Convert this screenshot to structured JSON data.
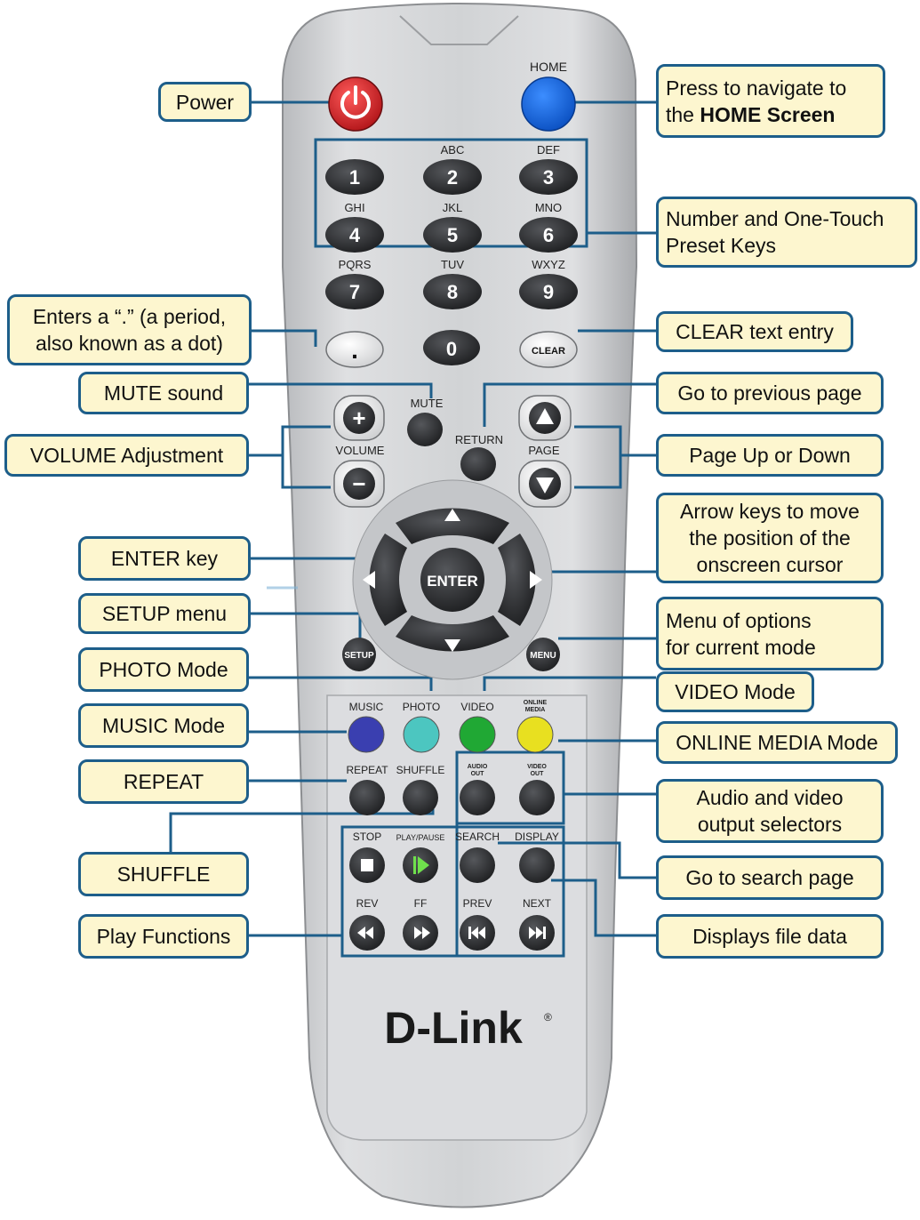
{
  "remote": {
    "colors": {
      "body": "#cfd1d4",
      "panel": "#dcdde0",
      "key": "#2f3033",
      "line": "#1d5e8a",
      "callout_bg": "#fdf6cf"
    },
    "top_keys": {
      "home_label": "HOME"
    },
    "number_keys": [
      {
        "digit": "1",
        "letters": ""
      },
      {
        "digit": "2",
        "letters": "ABC"
      },
      {
        "digit": "3",
        "letters": "DEF"
      },
      {
        "digit": "4",
        "letters": "GHI"
      },
      {
        "digit": "5",
        "letters": "JKL"
      },
      {
        "digit": "6",
        "letters": "MNO"
      },
      {
        "digit": "7",
        "letters": "PQRS"
      },
      {
        "digit": "8",
        "letters": "TUV"
      },
      {
        "digit": "9",
        "letters": "WXYZ"
      }
    ],
    "row_zero": {
      "dot": ".",
      "zero": "0",
      "clear": "CLEAR"
    },
    "volume": {
      "label": "VOLUME",
      "plus": "+",
      "minus": "−"
    },
    "mute_label": "MUTE",
    "return_label": "RETURN",
    "page_label": "PAGE",
    "enter_label": "ENTER",
    "setup_label": "SETUP",
    "menu_label": "MENU",
    "mode_keys": [
      {
        "label": "MUSIC",
        "color": "#3a3fb0"
      },
      {
        "label": "PHOTO",
        "color": "#4cc6c0"
      },
      {
        "label": "VIDEO",
        "color": "#20a834"
      },
      {
        "label": "ONLINE\nMEDIA",
        "color": "#e8e020"
      }
    ],
    "repeat_row": [
      "REPEAT",
      "SHUFFLE",
      "AUDIO\nOUT",
      "VIDEO\nOUT"
    ],
    "play_row": [
      "STOP",
      "PLAY/PAUSE",
      "SEARCH",
      "DISPLAY"
    ],
    "nav_row": [
      "REV",
      "FF",
      "PREV",
      "NEXT"
    ],
    "brand": "D-Link",
    "brand_mark": "®"
  },
  "callouts": {
    "power": "Power",
    "home": "Press to navigate to\nthe HOME Screen",
    "number": "Number and One-Touch\nPreset  Keys",
    "dot": "Enters a “.” (a period,\nalso known as a dot)",
    "clear": "CLEAR text entry",
    "mute": "MUTE sound",
    "previous": "Go to previous page",
    "volume": "VOLUME Adjustment",
    "page": "Page Up or Down",
    "arrow": "Arrow keys to move\nthe  position  of  the\nonscreen cursor",
    "enter": "ENTER key",
    "setup": "SETUP menu",
    "menu": "Menu of options\nfor current mode",
    "photo": "PHOTO Mode",
    "video": "VIDEO Mode",
    "music": "MUSIC Mode",
    "online": "ONLINE MEDIA Mode",
    "repeat": "REPEAT",
    "av": "Audio and video\noutput selectors",
    "shuffle": "SHUFFLE",
    "search": "Go to search page",
    "play": "Play Functions",
    "display": "Displays file data"
  }
}
